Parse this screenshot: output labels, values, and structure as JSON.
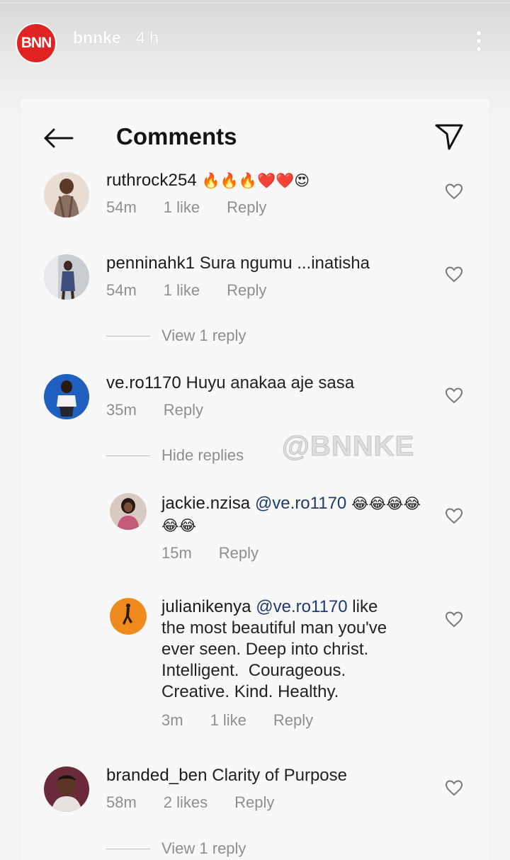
{
  "story": {
    "avatar_text": "BNN",
    "username": "bnnke",
    "time": "4 h"
  },
  "header": {
    "title": "Comments"
  },
  "watermark": "@BNNKE",
  "comments": [
    {
      "username": "ruthrock254",
      "text": "🔥🔥🔥❤️❤️😍",
      "time": "54m",
      "likes": "1 like",
      "reply": "Reply"
    },
    {
      "username": "penninahk1",
      "text": "Sura ngumu ...inatisha",
      "time": "54m",
      "likes": "1 like",
      "reply": "Reply",
      "replies_toggle": "View 1 reply"
    },
    {
      "username": "ve.ro1170",
      "text": "Huyu anakaa aje sasa",
      "time": "35m",
      "reply": "Reply",
      "replies_toggle": "Hide replies",
      "replies": [
        {
          "username": "jackie.nzisa",
          "mention": "@ve.ro1170",
          "text": "😂😂😂😂😂😂",
          "time": "15m",
          "reply": "Reply"
        },
        {
          "username": "julianikenya",
          "mention": "@ve.ro1170",
          "text_lines": [
            "like",
            "the most beautiful man you've",
            "ever seen. Deep into christ.",
            "Intelligent.  Courageous.",
            "Creative. Kind. Healthy."
          ],
          "time": "3m",
          "likes": "1 like",
          "reply": "Reply"
        }
      ]
    },
    {
      "username": "branded_ben",
      "text": "Clarity of Purpose",
      "time": "58m",
      "likes": "2 likes",
      "reply": "Reply",
      "replies_toggle": "View 1 reply"
    }
  ]
}
